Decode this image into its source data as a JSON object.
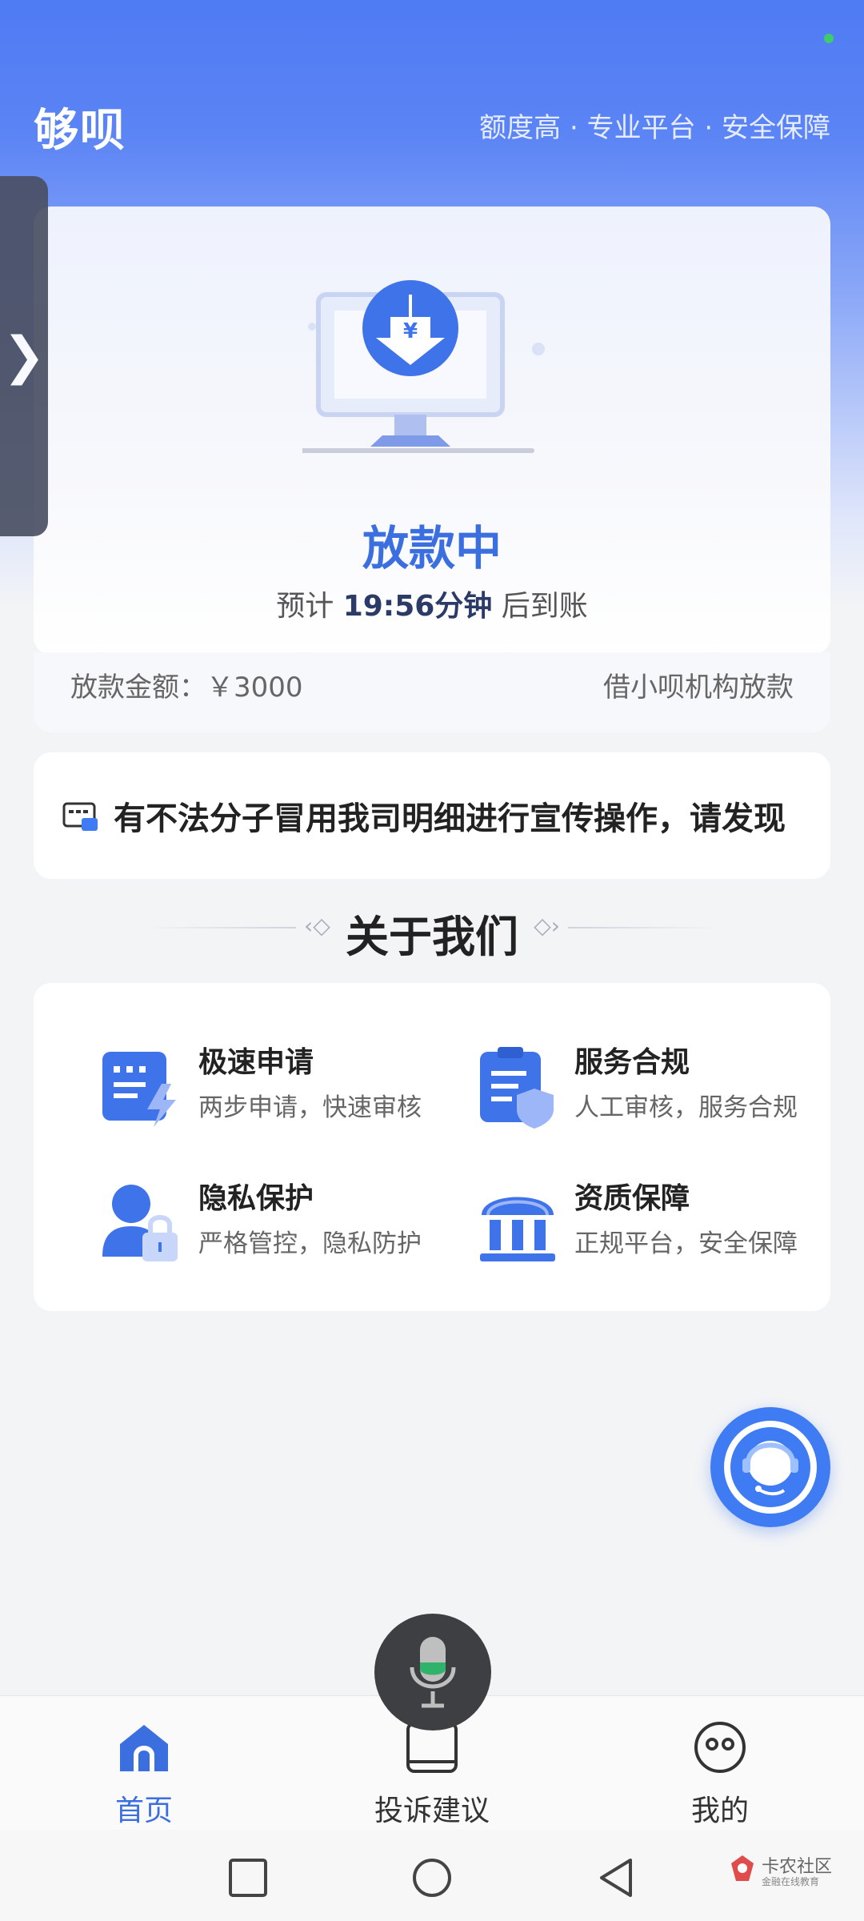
{
  "header": {
    "brand": "够呗",
    "slogan": "额度高 · 专业平台 · 安全保障"
  },
  "status_card": {
    "title": "放款中",
    "subtitle_prefix": "预计 ",
    "eta": "19:56分钟",
    "subtitle_suffix": " 后到账",
    "amount_label": "放款金额：￥3000",
    "lender": "借小呗机构放款"
  },
  "notice": {
    "text": "有不法分子冒用我司明细进行宣传操作，请发现"
  },
  "about": {
    "title": "关于我们",
    "features": [
      {
        "title": "极速申请",
        "desc": "两步申请，快速审核"
      },
      {
        "title": "服务合规",
        "desc": "人工审核，服务合规"
      },
      {
        "title": "隐私保护",
        "desc": "严格管控，隐私防护"
      },
      {
        "title": "资质保障",
        "desc": "正规平台，安全保障"
      }
    ]
  },
  "tabbar": {
    "items": [
      {
        "label": "首页"
      },
      {
        "label": "投诉建议"
      },
      {
        "label": "我的"
      }
    ]
  },
  "watermark": {
    "text": "卡农社区",
    "sub": "金融在线教育"
  },
  "colors": {
    "accent": "#3b6fe0",
    "header_blue": "#4f7bf3"
  }
}
